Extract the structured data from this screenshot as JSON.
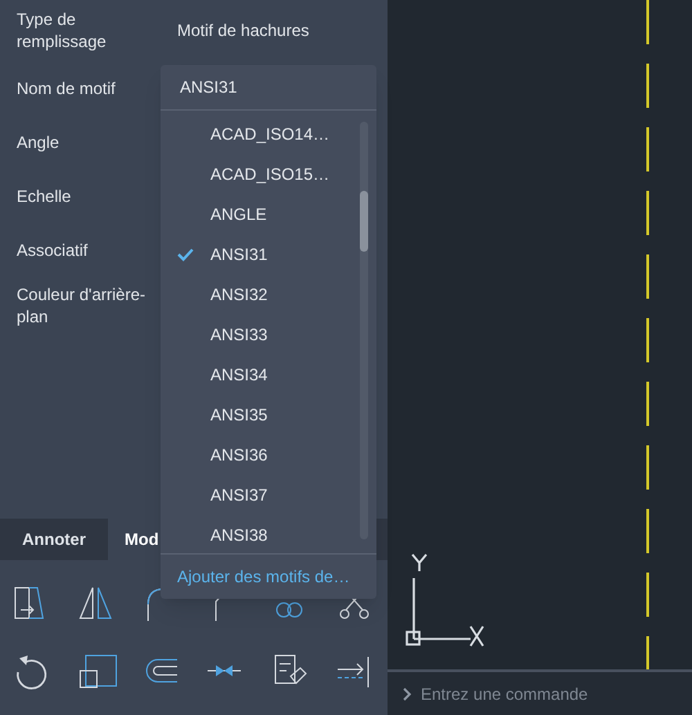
{
  "properties": [
    {
      "label": "Type de remplissage",
      "value": "Motif de hachures"
    },
    {
      "label": "Nom de motif"
    },
    {
      "label": "Angle"
    },
    {
      "label": "Echelle"
    },
    {
      "label": "Associatif"
    },
    {
      "label": "Couleur d'arrière-plan"
    }
  ],
  "pattern_dropdown": {
    "value": "ANSI31",
    "items": [
      {
        "label": "ACAD_ISO14…",
        "selected": false
      },
      {
        "label": "ACAD_ISO15…",
        "selected": false
      },
      {
        "label": "ANGLE",
        "selected": false
      },
      {
        "label": "ANSI31",
        "selected": true
      },
      {
        "label": "ANSI32",
        "selected": false
      },
      {
        "label": "ANSI33",
        "selected": false
      },
      {
        "label": "ANSI34",
        "selected": false
      },
      {
        "label": "ANSI35",
        "selected": false
      },
      {
        "label": "ANSI36",
        "selected": false
      },
      {
        "label": "ANSI37",
        "selected": false
      },
      {
        "label": "ANSI38",
        "selected": false
      }
    ],
    "footer_link": "Ajouter des motifs de…"
  },
  "ribbon_tabs": [
    {
      "label": "Annoter",
      "selected": false
    },
    {
      "label": "Mod",
      "selected": true
    }
  ],
  "command_line": {
    "placeholder": "Entrez une commande"
  }
}
